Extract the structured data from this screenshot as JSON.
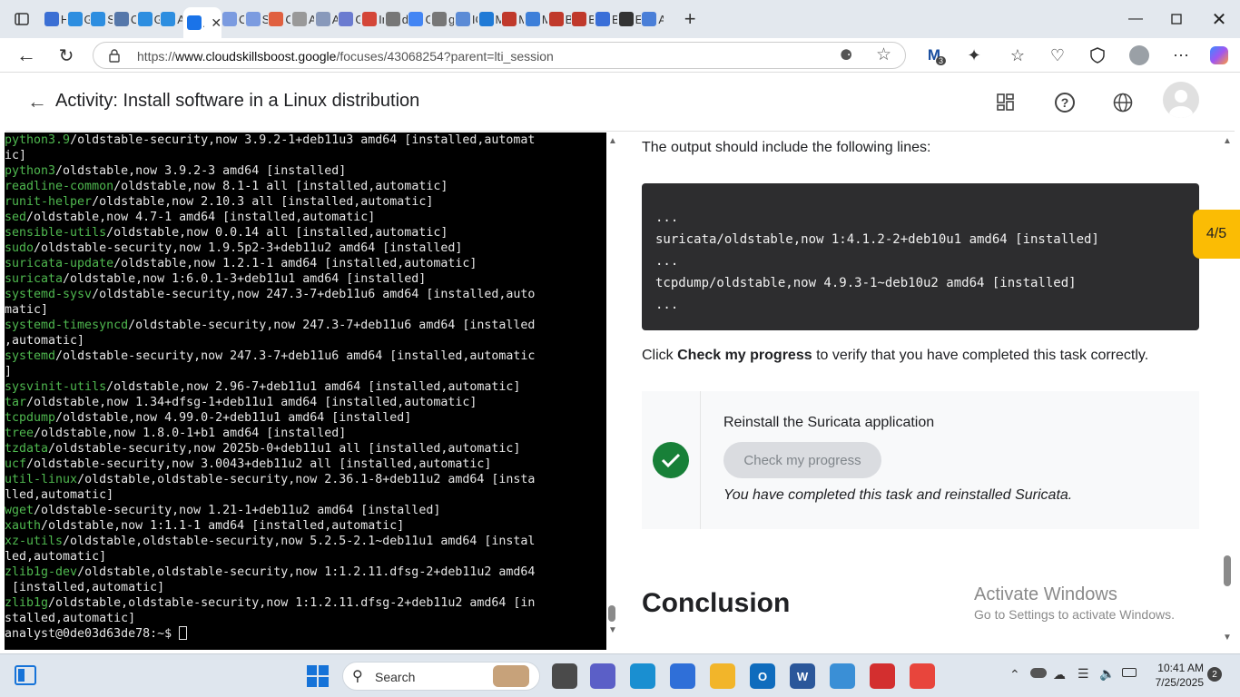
{
  "browser": {
    "tabs": [
      {
        "letter": "H",
        "fav": "#3b6fd4",
        "icon": "mail-icon"
      },
      {
        "letter": "G",
        "fav": "#2d8ee0",
        "icon": "google-cloud-icon"
      },
      {
        "letter": "Se",
        "fav": "#2d8ee0",
        "icon": "google-cloud-icon"
      },
      {
        "letter": "C",
        "fav": "#5577aa",
        "icon": "document-icon"
      },
      {
        "letter": "G",
        "fav": "#2d8ee0",
        "icon": "google-cloud-icon"
      },
      {
        "letter": "A",
        "fav": "#2d8ee0",
        "icon": "google-cloud-icon"
      },
      {
        "letter": "A",
        "fav": "#1a73e8",
        "icon": "cloud-skills-icon",
        "active": true
      },
      {
        "letter": "C",
        "fav": "#7b9be0",
        "icon": "cloud-icon"
      },
      {
        "letter": "Se",
        "fav": "#7b9be0",
        "icon": "cloud-icon"
      },
      {
        "letter": "C",
        "fav": "#e06040",
        "icon": "app-icon"
      },
      {
        "letter": "A",
        "fav": "#999999",
        "icon": "apple-icon"
      },
      {
        "letter": "A",
        "fav": "#8899bb",
        "icon": "shield-icon"
      },
      {
        "letter": "G",
        "fav": "#6a7bd0",
        "icon": "vscode-icon"
      },
      {
        "letter": "In",
        "fav": "#d44638",
        "icon": "gmail-icon"
      },
      {
        "letter": "d",
        "fav": "#777777",
        "icon": "search-icon"
      },
      {
        "letter": "G",
        "fav": "#4285f4",
        "icon": "google-icon"
      },
      {
        "letter": "g",
        "fav": "#777777",
        "icon": "search-icon"
      },
      {
        "letter": "IC",
        "fav": "#5b8bd6",
        "icon": "image-icon"
      },
      {
        "letter": "M",
        "fav": "#1f7ad6",
        "icon": "outlook-icon"
      },
      {
        "letter": "M",
        "fav": "#c0392b",
        "icon": "pdf-icon"
      },
      {
        "letter": "M",
        "fav": "#3d7fd9",
        "icon": "bing-icon"
      },
      {
        "letter": "B",
        "fav": "#c0392b",
        "icon": "pdf-icon"
      },
      {
        "letter": "B",
        "fav": "#c0392b",
        "icon": "pdf-icon"
      },
      {
        "letter": "B",
        "fav": "#3a6fd8",
        "icon": "bitwarden-icon"
      },
      {
        "letter": "E",
        "fav": "#333333",
        "icon": "github-icon"
      },
      {
        "letter": "A",
        "fav": "#4a7fd8",
        "icon": "chart-icon"
      }
    ],
    "url_prefix": "https://",
    "url_domain": "www.cloudskillsboost.google",
    "url_path": "/focuses/43068254?parent=lti_session",
    "profile_badge": "3"
  },
  "app": {
    "title": "Activity: Install software in a Linux distribution"
  },
  "terminal": {
    "lines": [
      {
        "pkg": "python3.9",
        "rest": "/oldstable-security,now 3.9.2-1+deb11u3 amd64 [installed,automat"
      },
      {
        "pkg": "",
        "rest": "ic]"
      },
      {
        "pkg": "python3",
        "rest": "/oldstable,now 3.9.2-3 amd64 [installed]"
      },
      {
        "pkg": "readline-common",
        "rest": "/oldstable,now 8.1-1 all [installed,automatic]"
      },
      {
        "pkg": "runit-helper",
        "rest": "/oldstable,now 2.10.3 all [installed,automatic]"
      },
      {
        "pkg": "sed",
        "rest": "/oldstable,now 4.7-1 amd64 [installed,automatic]"
      },
      {
        "pkg": "sensible-utils",
        "rest": "/oldstable,now 0.0.14 all [installed,automatic]"
      },
      {
        "pkg": "sudo",
        "rest": "/oldstable-security,now 1.9.5p2-3+deb11u2 amd64 [installed]"
      },
      {
        "pkg": "suricata-update",
        "rest": "/oldstable,now 1.2.1-1 amd64 [installed,automatic]"
      },
      {
        "pkg": "suricata",
        "rest": "/oldstable,now 1:6.0.1-3+deb11u1 amd64 [installed]"
      },
      {
        "pkg": "systemd-sysv",
        "rest": "/oldstable-security,now 247.3-7+deb11u6 amd64 [installed,auto"
      },
      {
        "pkg": "",
        "rest": "matic]"
      },
      {
        "pkg": "systemd-timesyncd",
        "rest": "/oldstable-security,now 247.3-7+deb11u6 amd64 [installed"
      },
      {
        "pkg": "",
        "rest": ",automatic]"
      },
      {
        "pkg": "systemd",
        "rest": "/oldstable-security,now 247.3-7+deb11u6 amd64 [installed,automatic"
      },
      {
        "pkg": "",
        "rest": "]"
      },
      {
        "pkg": "sysvinit-utils",
        "rest": "/oldstable,now 2.96-7+deb11u1 amd64 [installed,automatic]"
      },
      {
        "pkg": "tar",
        "rest": "/oldstable,now 1.34+dfsg-1+deb11u1 amd64 [installed,automatic]"
      },
      {
        "pkg": "tcpdump",
        "rest": "/oldstable,now 4.99.0-2+deb11u1 amd64 [installed]"
      },
      {
        "pkg": "tree",
        "rest": "/oldstable,now 1.8.0-1+b1 amd64 [installed]"
      },
      {
        "pkg": "tzdata",
        "rest": "/oldstable-security,now 2025b-0+deb11u1 all [installed,automatic]"
      },
      {
        "pkg": "ucf",
        "rest": "/oldstable-security,now 3.0043+deb11u2 all [installed,automatic]"
      },
      {
        "pkg": "util-linux",
        "rest": "/oldstable,oldstable-security,now 2.36.1-8+deb11u2 amd64 [insta"
      },
      {
        "pkg": "",
        "rest": "lled,automatic]"
      },
      {
        "pkg": "wget",
        "rest": "/oldstable-security,now 1.21-1+deb11u2 amd64 [installed]"
      },
      {
        "pkg": "xauth",
        "rest": "/oldstable,now 1:1.1-1 amd64 [installed,automatic]"
      },
      {
        "pkg": "xz-utils",
        "rest": "/oldstable,oldstable-security,now 5.2.5-2.1~deb11u1 amd64 [instal"
      },
      {
        "pkg": "",
        "rest": "led,automatic]"
      },
      {
        "pkg": "zlib1g-dev",
        "rest": "/oldstable,oldstable-security,now 1:1.2.11.dfsg-2+deb11u2 amd64"
      },
      {
        "pkg": "",
        "rest": " [installed,automatic]"
      },
      {
        "pkg": "zlib1g",
        "rest": "/oldstable,oldstable-security,now 1:1.2.11.dfsg-2+deb11u2 amd64 [in"
      },
      {
        "pkg": "",
        "rest": "stalled,automatic]"
      }
    ],
    "prompt": "analyst@0de03d63de78:~$ "
  },
  "lab": {
    "output_intro": "The output should include the following lines:",
    "code_lines": [
      "...",
      "suricata/oldstable,now 1:4.1.2-2+deb10u1 amd64 [installed]",
      "...",
      "tcpdump/oldstable,now 4.9.3-1~deb10u2 amd64 [installed]",
      "..."
    ],
    "click_prefix": "Click ",
    "click_bold": "Check my progress",
    "click_suffix": " to verify that you have completed this task correctly.",
    "task_title": "Reinstall the Suricata application",
    "progress_button": "Check my progress",
    "completed_text": "You have completed this task and reinstalled Suricata.",
    "conclusion_heading": "Conclusion",
    "progress_badge": "4/5"
  },
  "watermark": {
    "title": "Activate Windows",
    "subtitle": "Go to Settings to activate Windows."
  },
  "taskbar": {
    "search_placeholder": "Search",
    "time": "10:41 AM",
    "date": "7/25/2025",
    "notification_count": "2",
    "apps": [
      {
        "name": "file-manager-icon",
        "color": "#4a4a4a",
        "label": ""
      },
      {
        "name": "meet-icon",
        "color": "#5b5fc7",
        "label": ""
      },
      {
        "name": "edge-icon",
        "color": "#1a8fd1",
        "label": ""
      },
      {
        "name": "store-icon",
        "color": "#2f6fd8",
        "label": ""
      },
      {
        "name": "folder-icon",
        "color": "#f2b52a",
        "label": ""
      },
      {
        "name": "outlook-icon",
        "color": "#0f6cbd",
        "label": "O"
      },
      {
        "name": "word-icon",
        "color": "#2b579a",
        "label": "W"
      },
      {
        "name": "paint-icon",
        "color": "#3a8fd6",
        "label": ""
      },
      {
        "name": "acrobat-icon",
        "color": "#d32f2f",
        "label": ""
      },
      {
        "name": "chrome-icon",
        "color": "#e8453c",
        "label": ""
      }
    ]
  },
  "colors": {
    "terminal_bg": "#000000",
    "package_green": "#4fb84f",
    "badge_yellow": "#fbbc04",
    "check_green": "#188038"
  }
}
